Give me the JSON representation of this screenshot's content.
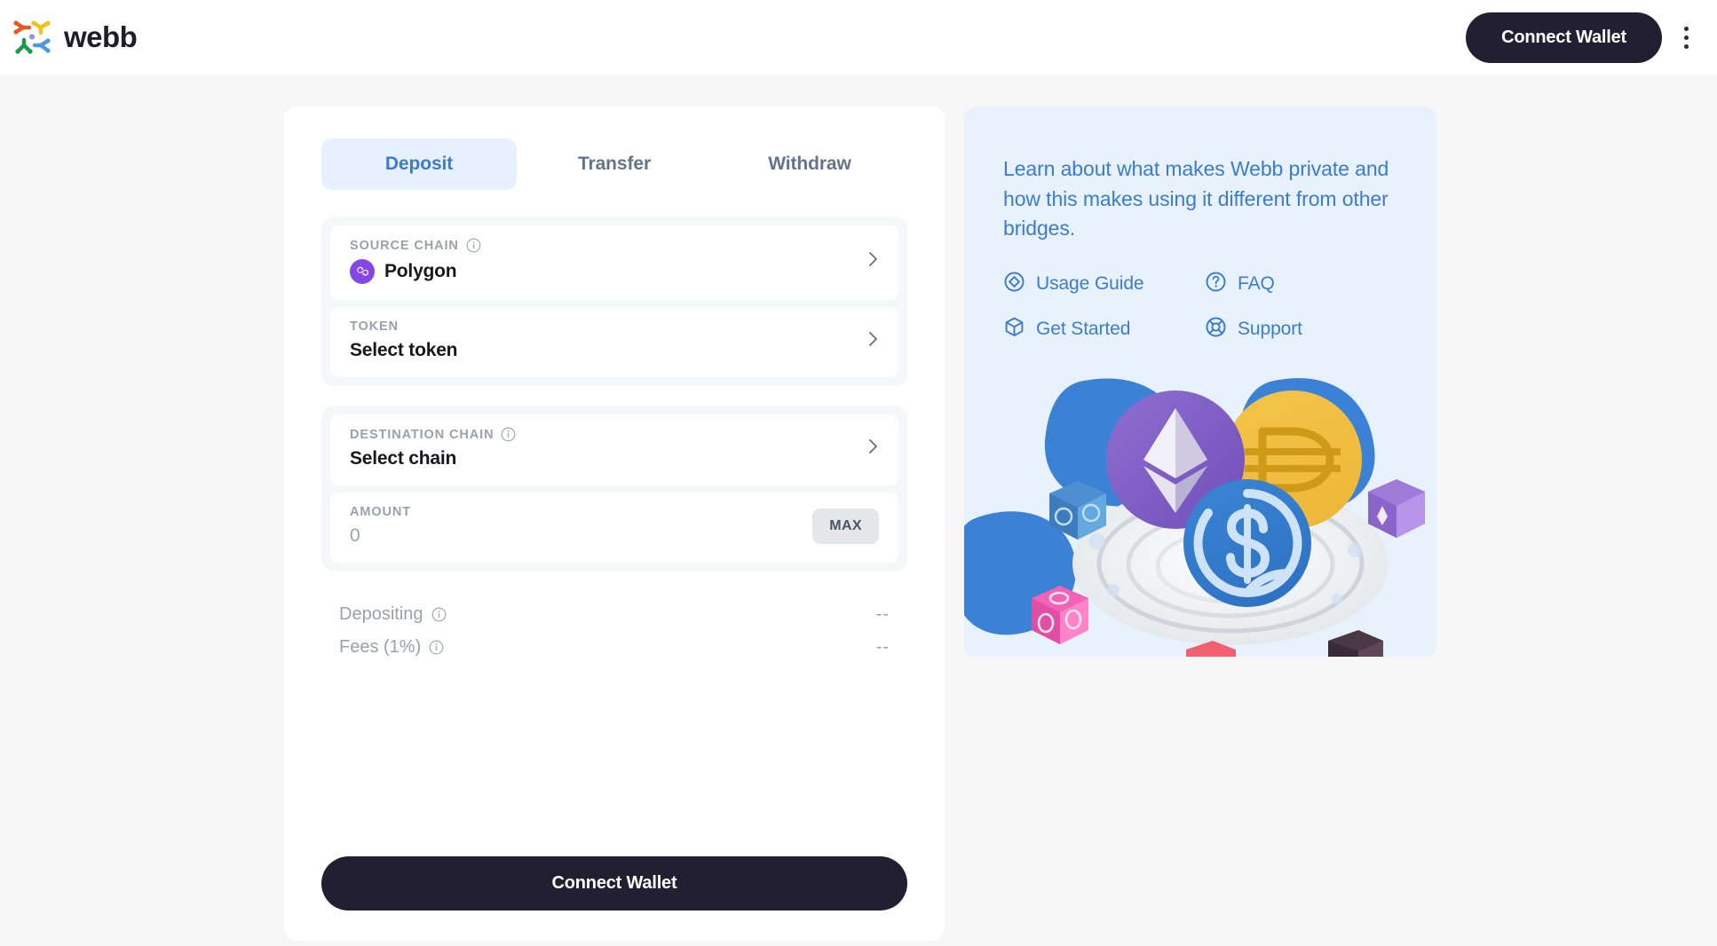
{
  "header": {
    "brand_name": "webb",
    "logo_icon": "webb-logo-icon",
    "connect_wallet_label": "Connect Wallet",
    "menu_icon": "kebab-menu-icon"
  },
  "bridge": {
    "tabs": [
      {
        "label": "Deposit",
        "active": true
      },
      {
        "label": "Transfer",
        "active": false
      },
      {
        "label": "Withdraw",
        "active": false
      }
    ],
    "source_chain": {
      "label": "SOURCE CHAIN",
      "value": "Polygon",
      "info_icon": "info-circle-icon",
      "chain_icon": "polygon-icon",
      "chevron_icon": "chevron-right-icon",
      "chain_color": "#8247e5"
    },
    "token": {
      "label": "TOKEN",
      "value": "Select token",
      "chevron_icon": "chevron-right-icon"
    },
    "destination_chain": {
      "label": "DESTINATION CHAIN",
      "value": "Select chain",
      "info_icon": "info-circle-icon",
      "chevron_icon": "chevron-right-icon"
    },
    "amount": {
      "label": "AMOUNT",
      "value": "0",
      "placeholder": "0",
      "max_label": "MAX"
    },
    "summary": [
      {
        "label": "Depositing",
        "value": "--",
        "info_icon": "info-circle-icon"
      },
      {
        "label": "Fees (1%)",
        "value": "--",
        "info_icon": "info-circle-icon"
      }
    ],
    "cta_label": "Connect Wallet"
  },
  "learn_panel": {
    "description": "Learn about what makes Webb private and how this makes using it different from other bridges.",
    "accent_color": "#3d7bce",
    "background_color": "#e8f2fd",
    "links": [
      {
        "label": "Usage Guide",
        "icon": "diamond-in-circle-icon"
      },
      {
        "label": "FAQ",
        "icon": "question-circle-icon"
      },
      {
        "label": "Get Started",
        "icon": "cube-icon"
      },
      {
        "label": "Support",
        "icon": "life-buoy-icon"
      }
    ],
    "illustration": "crypto-bridge-vortex-illustration"
  }
}
